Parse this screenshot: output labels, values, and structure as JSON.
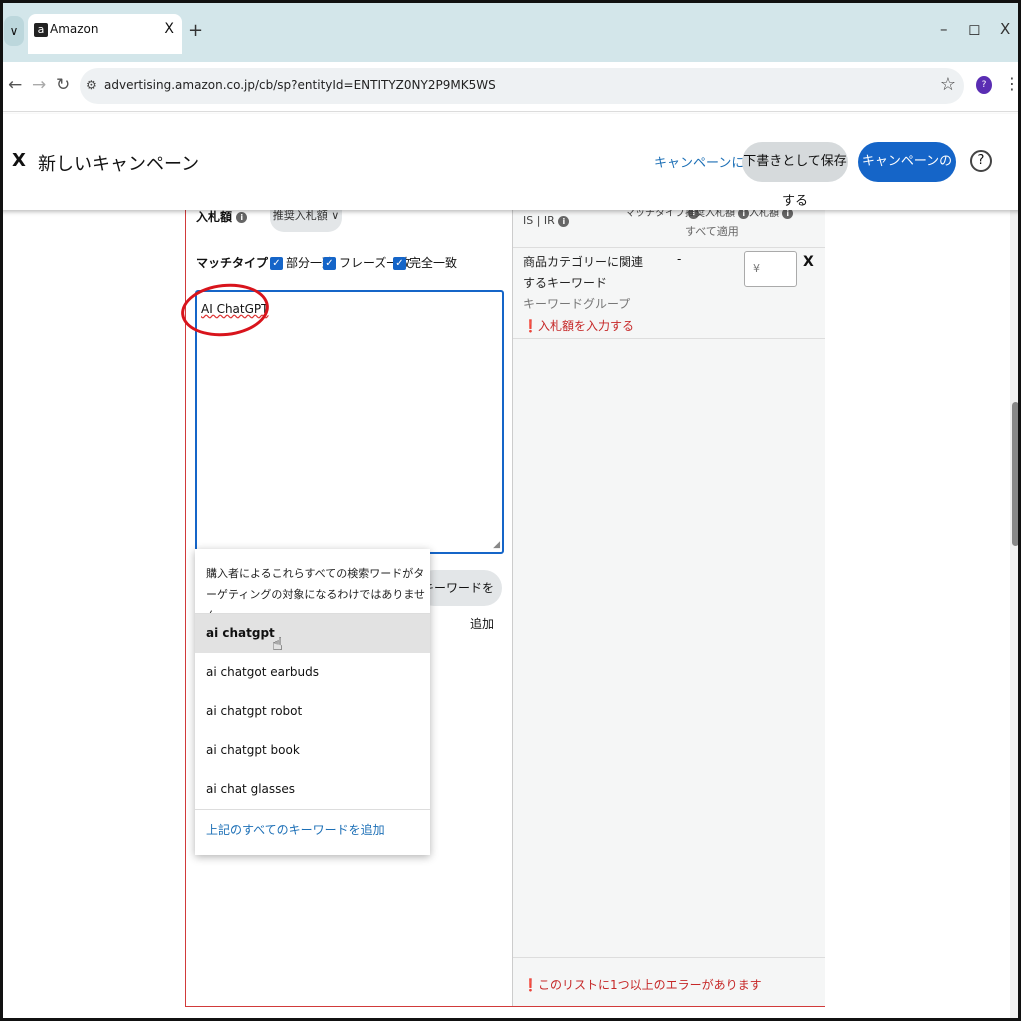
{
  "browser": {
    "tab_title": "Amazon",
    "tab_close": "X",
    "new_tab": "+",
    "url": "advertising.amazon.co.jp/cb/sp?entityId=ENTITYZ0NY2P9MK5WS",
    "profile_initial": "?",
    "win_min": "–",
    "win_max": "◻",
    "win_close": "X"
  },
  "header": {
    "close": "X",
    "title": "新しいキャンペーン",
    "back_link": "キャンペーンに戻る",
    "save_draft": "下書きとして保存する",
    "start": "キャンペーンの開始",
    "help": "?"
  },
  "left": {
    "bid_label": "入札額",
    "bid_dropdown": "推奨入札額 ∨",
    "match_label": "マッチタイプ",
    "match_options": [
      "部分一致",
      "フレーズ一致",
      "完全一致"
    ],
    "textarea_value": "AI ChatGPT",
    "add_keyword_button": "キーワードを追加"
  },
  "suggestions": {
    "note": "購入者によるこれらすべての検索ワードがターゲティングの対象になるわけではありません。",
    "items": [
      "ai chatgpt",
      "ai chatgot earbuds",
      "ai chatgpt robot",
      "ai chatgpt book",
      "ai chat glasses"
    ],
    "add_all": "上記のすべてのキーワードを追加"
  },
  "right": {
    "header_is_ir": "IS | IR",
    "header_match": "マッチタイプ",
    "header_suggested": "推奨入札額",
    "header_bid": "入札額",
    "apply_all": "すべて適用",
    "row": {
      "keyword": "商品カテゴリーに関連するキーワード",
      "suggested": "-",
      "group": "キーワードグループ",
      "error": "入札額を入力する",
      "bid_placeholder": "¥",
      "remove": "X"
    },
    "list_error": "このリストに1つ以上のエラーがあります"
  }
}
